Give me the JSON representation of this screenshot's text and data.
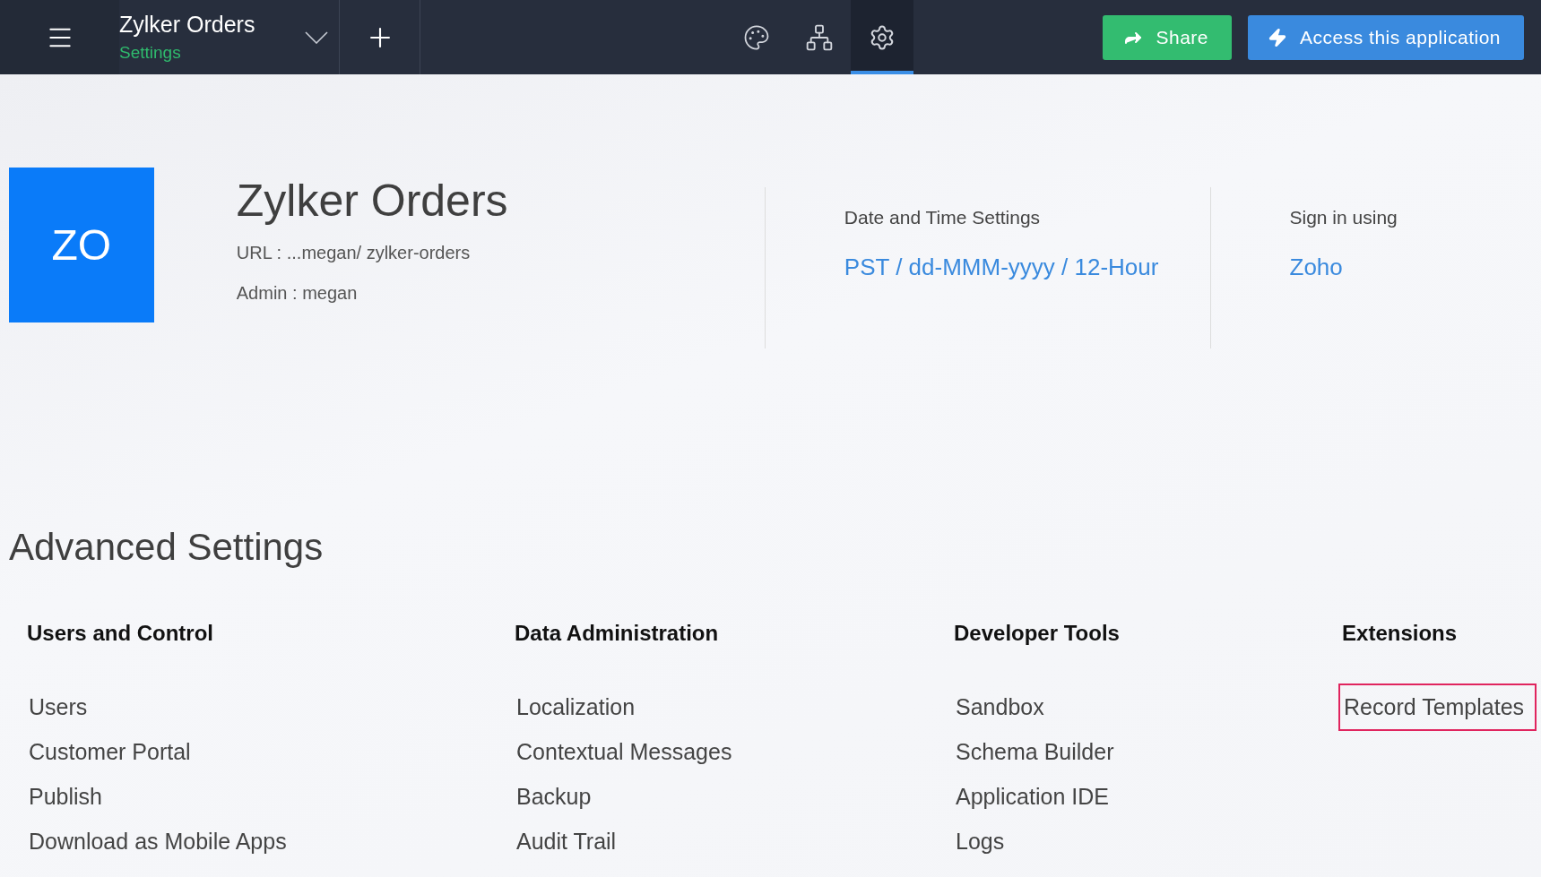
{
  "topbar": {
    "app_name": "Zylker Orders",
    "subtitle": "Settings",
    "tools": [
      {
        "kind": "palette",
        "selected": false
      },
      {
        "kind": "hierarchy",
        "selected": false
      },
      {
        "kind": "settings",
        "selected": true
      }
    ],
    "buttons": [
      {
        "kind": "share",
        "label": "Share"
      },
      {
        "kind": "access",
        "label": "Access this application"
      }
    ]
  },
  "app_info": {
    "initials": "ZO",
    "title": "Zylker Orders",
    "details": [
      {
        "label": "URL :",
        "value": "...megan/ zylker-orders"
      },
      {
        "label": "Admin :",
        "value": "megan"
      }
    ],
    "settings": [
      {
        "label": "Date and Time Settings",
        "value": "PST / dd-MMM-yyyy / 12-Hour"
      },
      {
        "label": "Sign in using",
        "value": "Zoho"
      }
    ]
  },
  "advanced_settings": {
    "title": "Advanced Settings",
    "sections": [
      {
        "heading": "Users and Control",
        "items": [
          {
            "label": "Users",
            "highlighted": false
          },
          {
            "label": "Customer Portal",
            "highlighted": false
          },
          {
            "label": "Publish",
            "highlighted": false
          },
          {
            "label": "Download as Mobile Apps",
            "highlighted": false
          }
        ]
      },
      {
        "heading": "Data Administration",
        "items": [
          {
            "label": "Localization",
            "highlighted": false
          },
          {
            "label": "Contextual Messages",
            "highlighted": false
          },
          {
            "label": "Backup",
            "highlighted": false
          },
          {
            "label": "Audit Trail",
            "highlighted": false
          }
        ]
      },
      {
        "heading": "Developer Tools",
        "items": [
          {
            "label": "Sandbox",
            "highlighted": false
          },
          {
            "label": "Schema Builder",
            "highlighted": false
          },
          {
            "label": "Application IDE",
            "highlighted": false
          },
          {
            "label": "Logs",
            "highlighted": false
          }
        ]
      },
      {
        "heading": "Extensions",
        "items": [
          {
            "label": "Record Templates",
            "highlighted": true
          }
        ]
      }
    ]
  }
}
